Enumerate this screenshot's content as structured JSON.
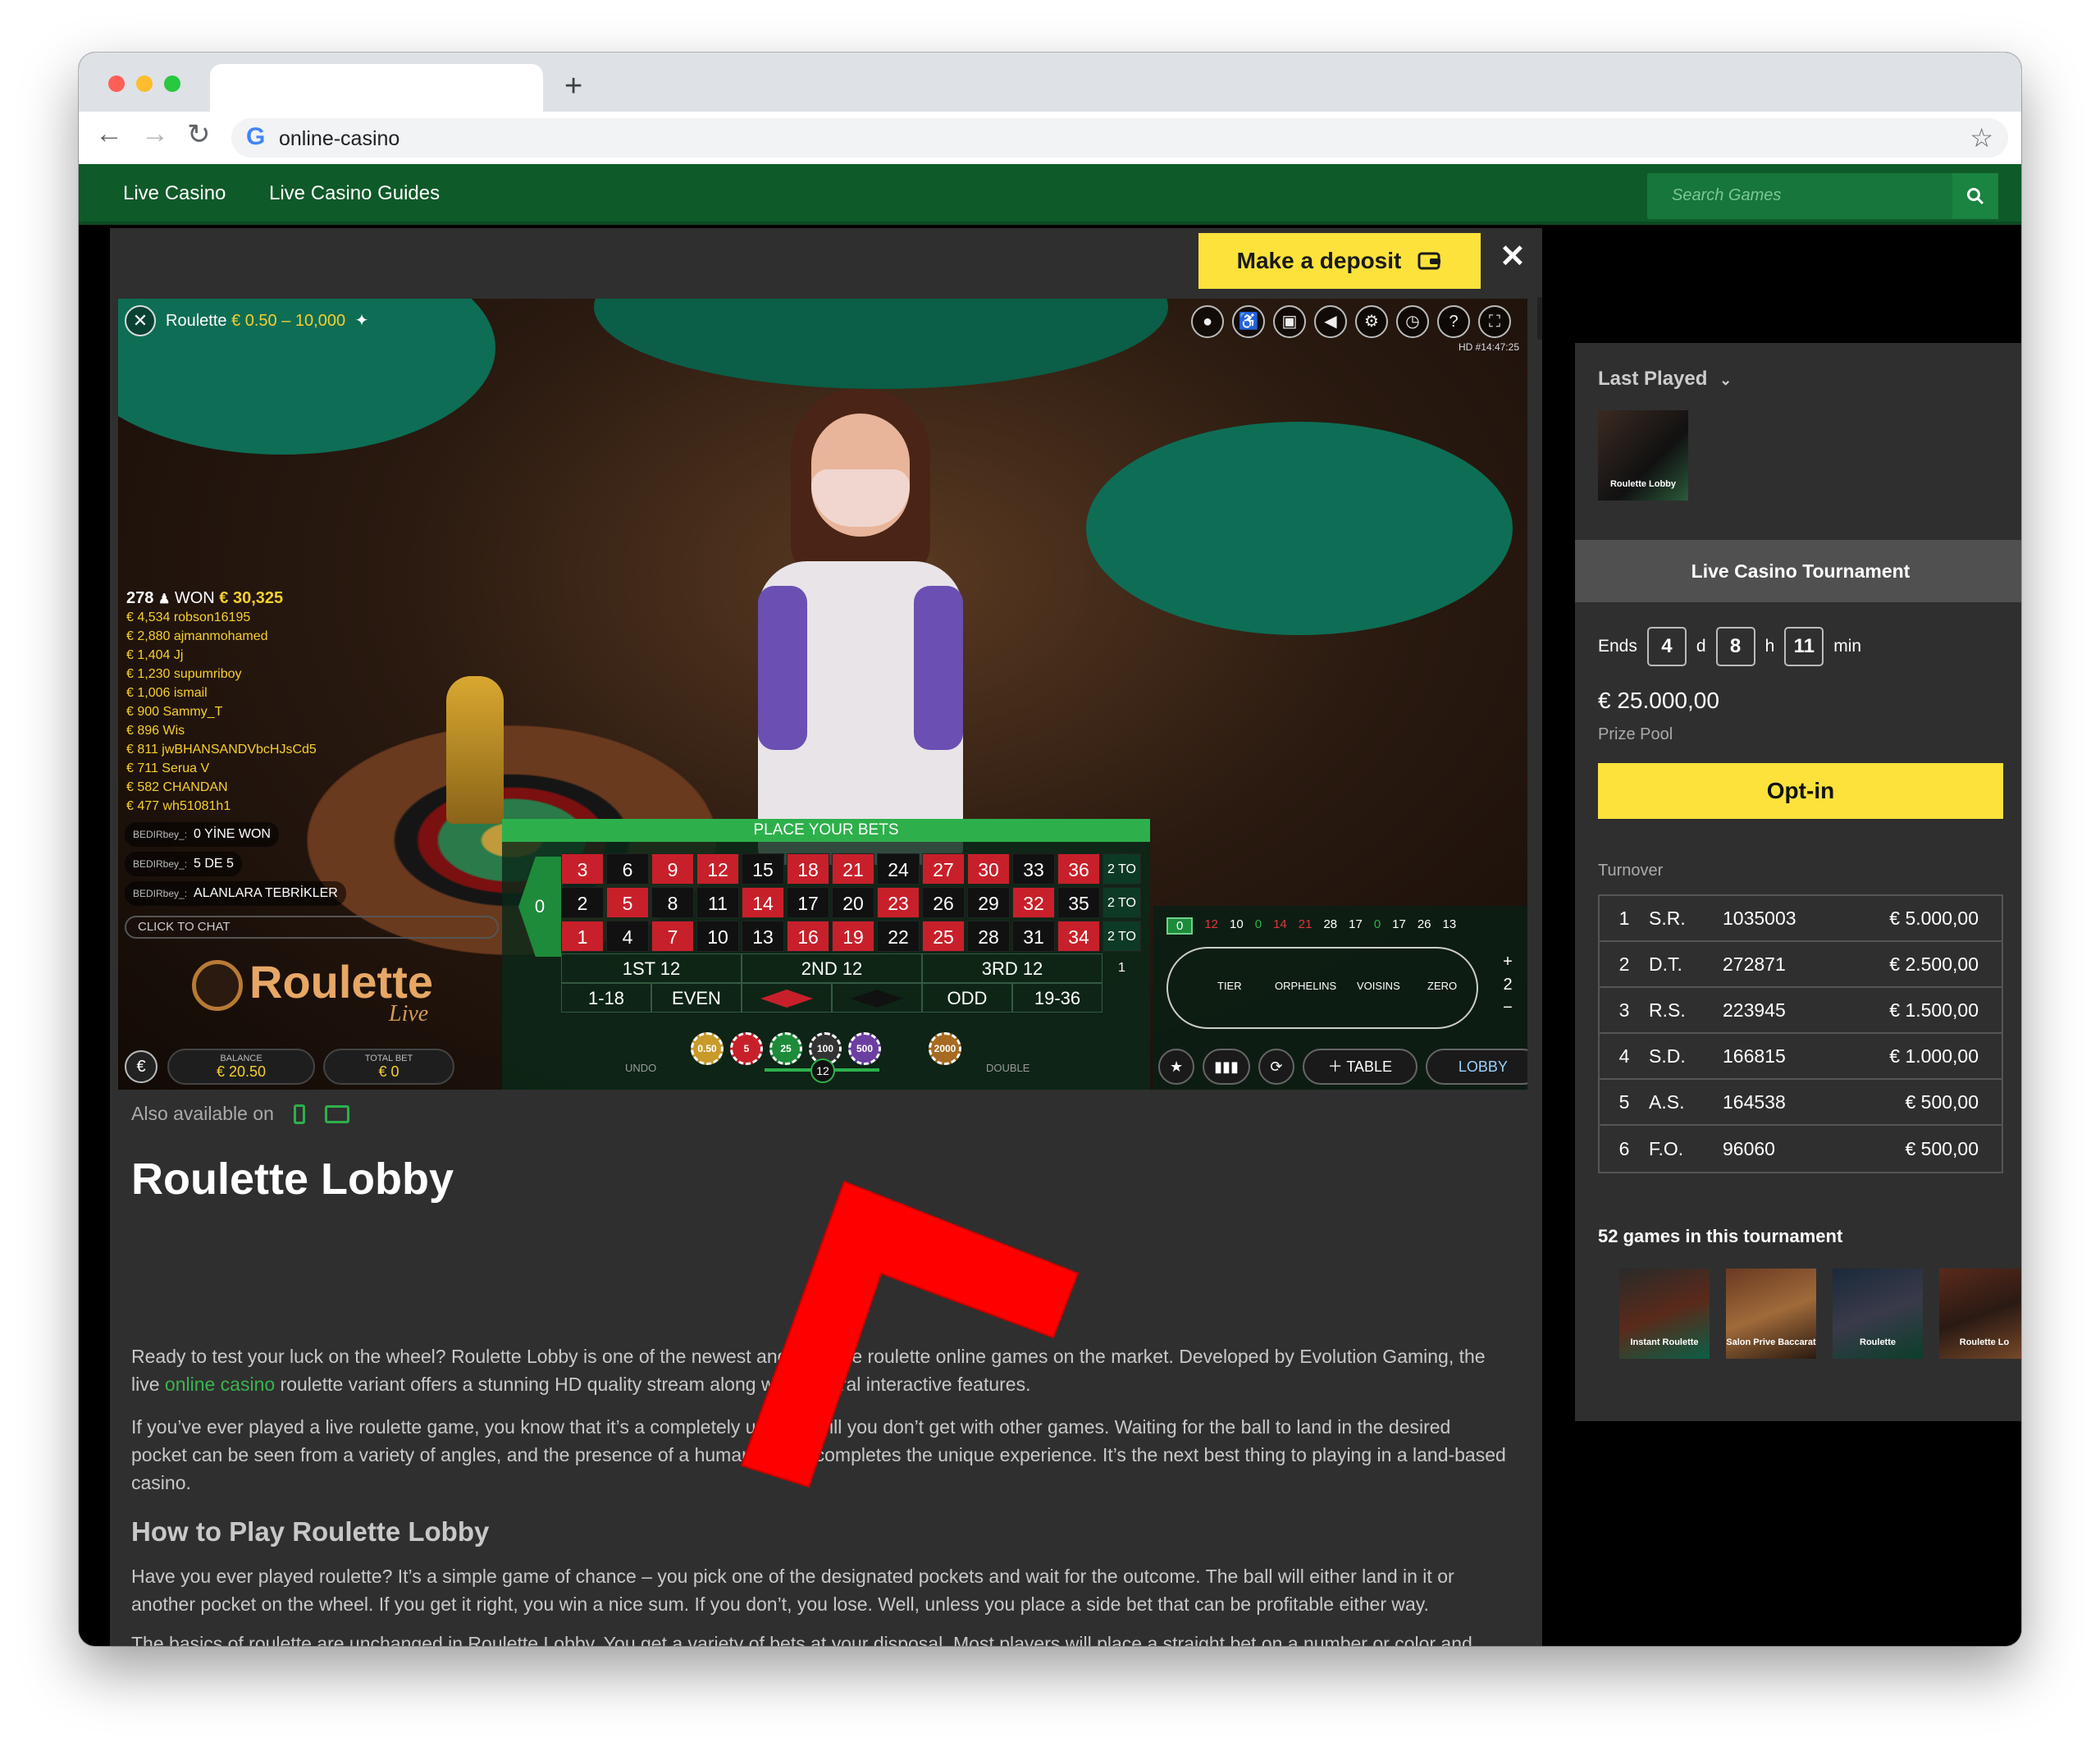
{
  "browser": {
    "url": "online-casino",
    "new_tab": "+",
    "back": "←",
    "forward": "→",
    "reload": "↻",
    "bookmark": "☆",
    "google_icon": "G"
  },
  "nav": {
    "links": [
      "Live Casino",
      "Live Casino Guides"
    ],
    "search_placeholder": "Search Games",
    "search_icon": "magnifier-icon"
  },
  "deposit": {
    "label": "Make a deposit",
    "close": "✕"
  },
  "game": {
    "table_name": "Roulette",
    "limits": "€ 0.50 – 10,000",
    "stream_info": "HD  #14:47:25",
    "winners": {
      "count": "278",
      "won_label": "WON",
      "total": "€ 30,325",
      "list": [
        "€ 4,534 robson16195",
        "€ 2,880 ajmanmohamed",
        "€ 1,404 Jj",
        "€ 1,230 supumriboy",
        "€ 1,006 ismail",
        "€ 900 Sammy_T",
        "€ 896 Wis",
        "€ 811 jwBHANSANDVbcHJsCd5",
        "€ 711 Serua V",
        "€ 582 CHANDAN",
        "€ 477 wh51081h1"
      ]
    },
    "chat": [
      {
        "user": "BEDIRbey_:",
        "msg": "0 YİNE WON"
      },
      {
        "user": "BEDIRbey_:",
        "msg": "5 DE 5"
      },
      {
        "user": "BEDIRbey_:",
        "msg": "ALANLARA TEBRİKLER"
      }
    ],
    "click_to_chat": "CLICK TO CHAT",
    "brand_name": "Roulette",
    "brand_sub": "Live",
    "balance_label": "BALANCE",
    "balance": "€ 20.50",
    "total_bet_label": "TOTAL BET",
    "total_bet": "€ 0",
    "currency_icon": "€",
    "place_bets": "PLACE YOUR BETS",
    "zero": "0",
    "rows": [
      [
        "3",
        "6",
        "9",
        "12",
        "15",
        "18",
        "21",
        "24",
        "27",
        "30",
        "33",
        "36"
      ],
      [
        "2",
        "5",
        "8",
        "11",
        "14",
        "17",
        "20",
        "23",
        "26",
        "29",
        "32",
        "35"
      ],
      [
        "1",
        "4",
        "7",
        "10",
        "13",
        "16",
        "19",
        "22",
        "25",
        "28",
        "31",
        "34"
      ]
    ],
    "red_numbers": [
      "1",
      "3",
      "5",
      "7",
      "9",
      "12",
      "14",
      "16",
      "18",
      "19",
      "21",
      "23",
      "25",
      "27",
      "30",
      "32",
      "34",
      "36"
    ],
    "column_bet": "2 TO 1",
    "dozens": [
      "1ST 12",
      "2ND 12",
      "3RD 12"
    ],
    "outside": [
      "1-18",
      "EVEN",
      "",
      "",
      "ODD",
      "19-36"
    ],
    "chips": [
      "0.50",
      "5",
      "25",
      "100",
      "500",
      "2000"
    ],
    "undo": "UNDO",
    "double": "DOUBLE",
    "timer": "12",
    "recent": [
      "0",
      "12",
      "10",
      "0",
      "14",
      "21",
      "28",
      "17",
      "0",
      "17",
      "26",
      "13"
    ],
    "recent_colors": [
      "g",
      "r",
      "w",
      "g",
      "r",
      "r",
      "w",
      "w",
      "g",
      "w",
      "w",
      "w"
    ],
    "racetrack": [
      "TIER",
      "ORPHELINS",
      "VOISINS",
      "ZERO"
    ],
    "race_ctrl": [
      "+",
      "2",
      "−"
    ],
    "buttons": [
      "★",
      "📊",
      "⟳",
      "＋ TABLE",
      "LOBBY"
    ]
  },
  "page": {
    "also_available": "Also available on",
    "title": "Roulette Lobby",
    "p1_a": "Ready to test your luck on the wheel? Roulette Lobby is one of the newest and best live roulette online games on the market. Developed by Evolution Gaming, the live ",
    "p1_link": "online casino",
    "p1_b": " roulette variant offers a stunning HD quality stream along with several interactive features.",
    "p2": "If you’ve ever played a live roulette game, you know that it’s a completely unique thrill you don’t get with other games. Waiting for the ball to land in the desired pocket can be seen from a variety of angles, and the presence of a human dealer completes the unique experience. It’s the next best thing to playing in a land-based casino.",
    "h2": "How to Play Roulette Lobby",
    "p3": "Have you ever played roulette? It’s a simple game of chance – you pick one of the designated pockets and wait for the outcome. The ball will either land in it or another pocket on the wheel. If you get it right, you win a nice sum. If you don’t, you lose. Well, unless you place a side bet that can be profitable either way.",
    "p4": "The basics of roulette are unchanged in Roulette Lobby. You get a variety of bets at your disposal. Most players will place a straight bet on a number or color and spin the wheel to test their luck. The good thing about Roulette Lobby is that it allows plenty of side bet that raise your chances to win."
  },
  "sidebar": {
    "last_played": "Last Played",
    "last_played_game": "Roulette Lobby",
    "tournament_title": "Live Casino Tournament",
    "ends_label": "Ends",
    "days": "4",
    "days_unit": "d",
    "hours": "8",
    "hours_unit": "h",
    "minutes": "11",
    "minutes_unit": "min",
    "prize_pool": "€ 25.000,00",
    "prize_pool_label": "Prize Pool",
    "opt_in": "Opt-in",
    "turnover_label": "Turnover",
    "leaderboard": [
      {
        "rank": "1",
        "name": "S.R.",
        "score": "1035003",
        "prize": "€ 5.000,00"
      },
      {
        "rank": "2",
        "name": "D.T.",
        "score": "272871",
        "prize": "€ 2.500,00"
      },
      {
        "rank": "3",
        "name": "R.S.",
        "score": "223945",
        "prize": "€ 1.500,00"
      },
      {
        "rank": "4",
        "name": "S.D.",
        "score": "166815",
        "prize": "€ 1.000,00"
      },
      {
        "rank": "5",
        "name": "A.S.",
        "score": "164538",
        "prize": "€ 500,00"
      },
      {
        "rank": "6",
        "name": "F.O.",
        "score": "96060",
        "prize": "€ 500,00"
      }
    ],
    "games_count_label": "52 games in this tournament",
    "games": [
      "Instant Roulette",
      "Salon Prive Baccarat",
      "Roulette",
      "Roulette Lo"
    ]
  },
  "colors": {
    "brand_green": "#0f5a29",
    "accent_yellow": "#fce23b",
    "roulette_red": "#c8202a",
    "link_green": "#3ab44e",
    "arrow_red": "#ff0000"
  }
}
